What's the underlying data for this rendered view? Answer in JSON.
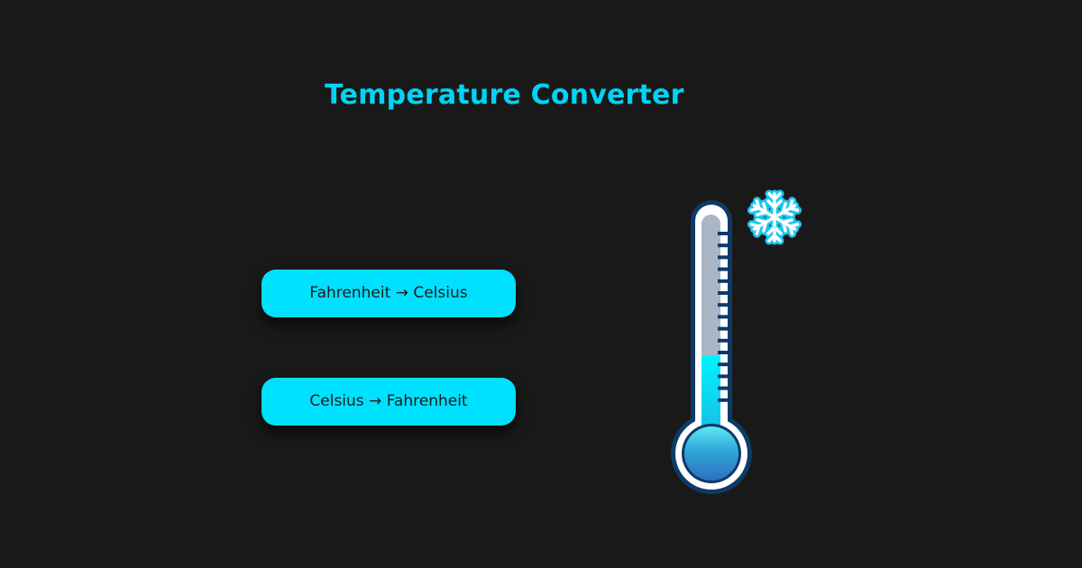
{
  "app": {
    "title": "Temperature Converter"
  },
  "buttons": {
    "f_to_c": "Fahrenheit → Celsius",
    "c_to_f": "Celsius → Fahrenheit"
  },
  "thermometer": {
    "icon": "thermometer-icon",
    "indicator_icon": "snowflake-icon",
    "mercury_level": 0.35
  },
  "colors": {
    "background": "#191919",
    "accent": "#00e0ff",
    "title": "#00d4f5",
    "thermometer_outline": "#0e3a66",
    "bulb": "#2f78bf"
  }
}
